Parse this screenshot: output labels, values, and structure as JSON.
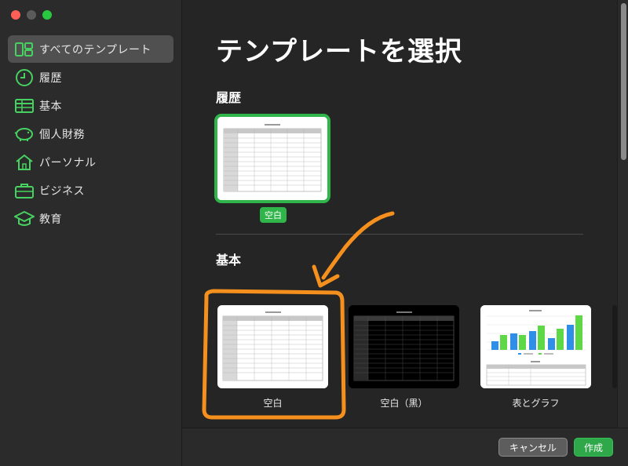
{
  "window": {
    "controls": [
      "close",
      "minimize",
      "zoom"
    ]
  },
  "sidebar": {
    "items": [
      {
        "label": "すべてのテンプレート",
        "icon": "all-templates-icon",
        "selected": true
      },
      {
        "label": "履歴",
        "icon": "clock-icon"
      },
      {
        "label": "基本",
        "icon": "table-icon"
      },
      {
        "label": "個人財務",
        "icon": "piggy-bank-icon"
      },
      {
        "label": "パーソナル",
        "icon": "house-icon"
      },
      {
        "label": "ビジネス",
        "icon": "briefcase-icon"
      },
      {
        "label": "教育",
        "icon": "graduation-cap-icon"
      }
    ]
  },
  "main": {
    "title": "テンプレートを選択",
    "sections": {
      "history": {
        "heading": "履歴",
        "template": {
          "badge": "空白"
        }
      },
      "basic": {
        "heading": "基本",
        "templates": [
          {
            "label": "空白"
          },
          {
            "label": "空白（黒）"
          },
          {
            "label": "表とグラフ"
          }
        ]
      }
    }
  },
  "footer": {
    "cancel_label": "キャンセル",
    "create_label": "作成"
  },
  "colors": {
    "accent": "#2fb54a",
    "annotation": "#f5901e",
    "sidebar_icon": "#46d160"
  }
}
